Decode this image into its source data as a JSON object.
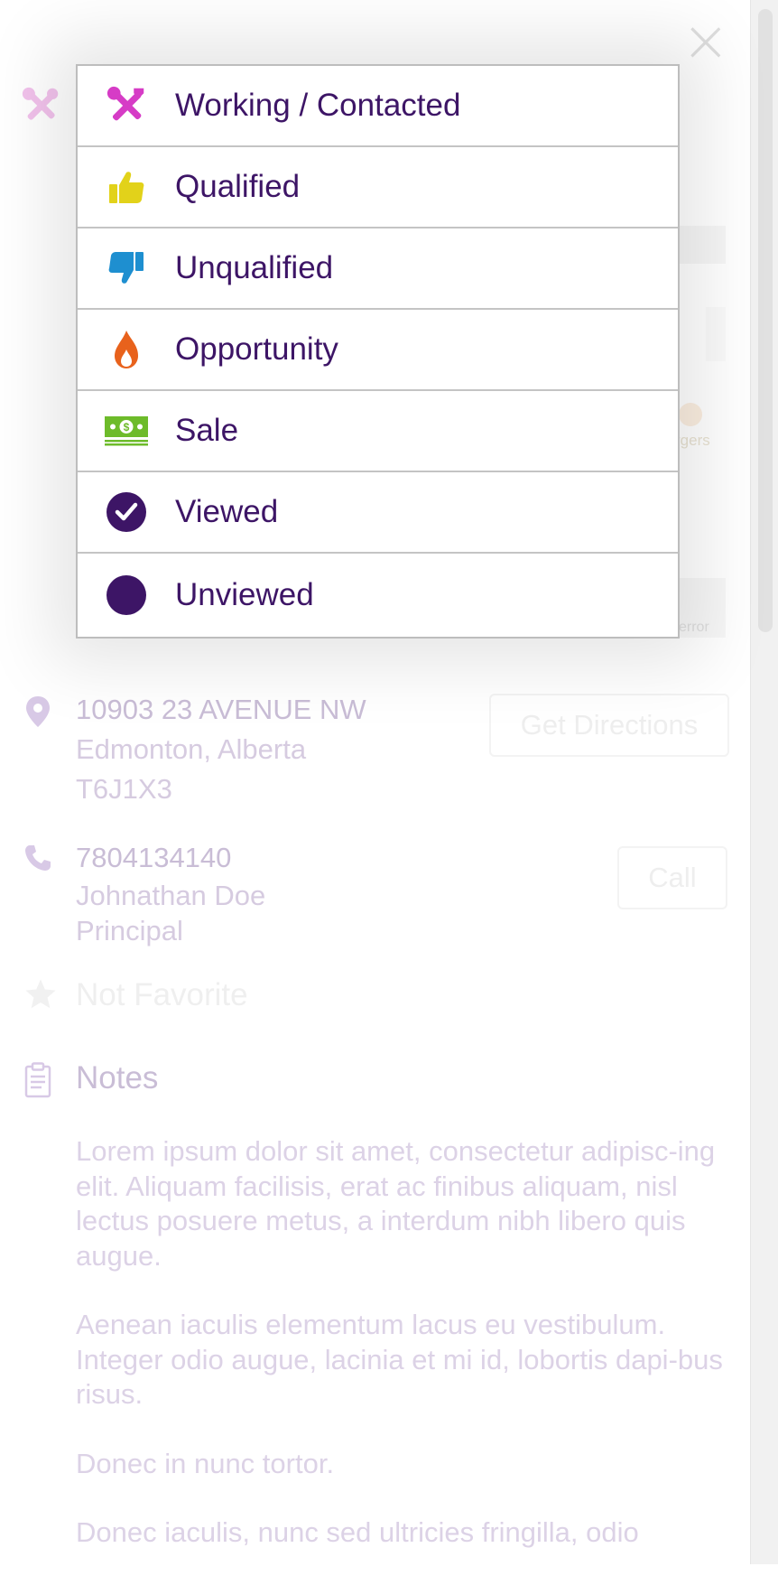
{
  "close_icon": "close-icon",
  "status_menu": {
    "items": [
      {
        "label": "Working / Contacted",
        "icon": "tools-icon",
        "color": "#d63cc6"
      },
      {
        "label": "Qualified",
        "icon": "thumbs-up-icon",
        "color": "#e2d21a"
      },
      {
        "label": "Unqualified",
        "icon": "thumbs-down-icon",
        "color": "#1e8fd0"
      },
      {
        "label": "Opportunity",
        "icon": "flame-icon",
        "color": "#e8621c"
      },
      {
        "label": "Sale",
        "icon": "money-icon",
        "color": "#6dbb2a"
      },
      {
        "label": "Viewed",
        "icon": "check-circle-icon",
        "color": "#3d1566"
      },
      {
        "label": "Unviewed",
        "icon": "filled-circle-icon",
        "color": "#3d1566"
      }
    ]
  },
  "background": {
    "peek_category": "rgers",
    "peek_error": "error",
    "address": {
      "line1": "10903 23 AVENUE NW",
      "line2": "Edmonton, Alberta",
      "line3": "T6J1X3",
      "directions_button": "Get Directions"
    },
    "contact": {
      "phone": "7804134140",
      "name": "Johnathan Doe",
      "role": "Principal",
      "call_button": "Call"
    },
    "favorite_label": "Not Favorite",
    "notes": {
      "title": "Notes",
      "paragraphs": [
        "Lorem ipsum dolor sit amet, consectetur adipisc-ing elit. Aliquam facilisis, erat ac finibus aliquam, nisl lectus posuere metus, a interdum nibh libero quis augue.",
        "Aenean iaculis elementum lacus eu vestibulum. Integer odio augue, lacinia et mi id, lobortis dapi-bus risus.",
        "Donec in nunc tortor.",
        "Donec iaculis, nunc sed ultricies fringilla, odio"
      ]
    }
  },
  "colors": {
    "accent": "#3d1566",
    "dimmed_text": "#c9bdd6"
  }
}
